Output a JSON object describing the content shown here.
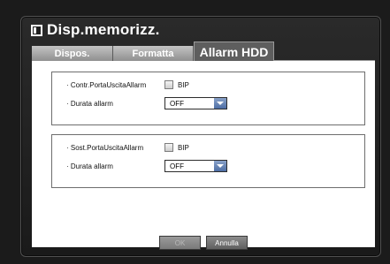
{
  "window": {
    "title": "Disp.memorizz."
  },
  "tabs": [
    {
      "label": "Dispos.",
      "active": false
    },
    {
      "label": "Formatta",
      "active": false
    },
    {
      "label": "Allarm HDD",
      "active": true
    }
  ],
  "groups": [
    {
      "alarm_label": "· Contr.PortaUscitaAllarm",
      "checkbox_label": "BIP",
      "checked": false,
      "duration_label": "· Durata allarm",
      "duration_value": "OFF"
    },
    {
      "alarm_label": "· Sost.PortaUscitaAllarm",
      "checkbox_label": "BIP",
      "checked": false,
      "duration_label": "· Durata allarm",
      "duration_value": "OFF"
    }
  ],
  "buttons": {
    "ok_label": "OK",
    "ok_enabled": false,
    "cancel_label": "Annulla"
  },
  "colors": {
    "dialog_background": "#1b1b1b",
    "tab_active_background": "#5e5e5e",
    "select_arrow_accent": "#4d6ea5"
  }
}
